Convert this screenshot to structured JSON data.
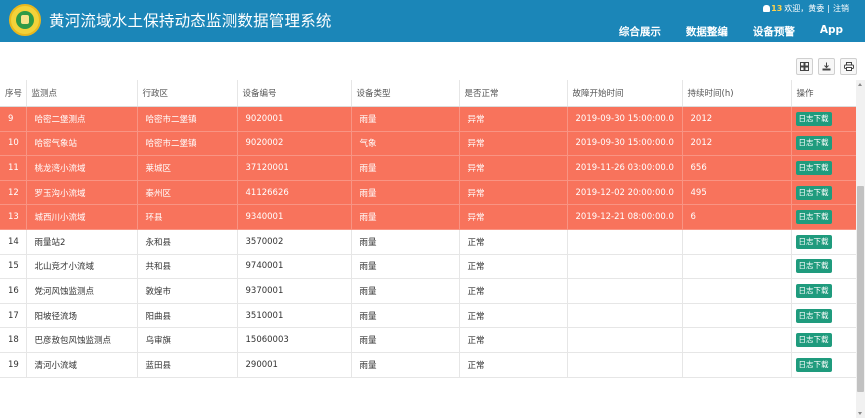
{
  "app": {
    "title": "黄河流域水土保持动态监测数据管理系统",
    "logo_icon": "logo-emblem-icon"
  },
  "user_bar": {
    "notification_count": "13",
    "welcome": "欢迎，黄委",
    "separator": "|",
    "logout": "注销"
  },
  "nav": [
    {
      "label": "综合展示"
    },
    {
      "label": "数据整编"
    },
    {
      "label": "设备预警"
    },
    {
      "label": "App"
    }
  ],
  "toolbar": {
    "columns_icon": "grid-icon",
    "export_icon": "download-icon",
    "print_icon": "print-icon"
  },
  "table": {
    "headers": [
      "序号",
      "监测点",
      "行政区",
      "设备编号",
      "设备类型",
      "是否正常",
      "故障开始时间",
      "持续时间(h)",
      "操作"
    ],
    "rows": [
      {
        "no": "9",
        "site": "哈密二堡测点",
        "region": "哈密市二堡镇",
        "device": "9020001",
        "type": "雨量",
        "status": "异常",
        "start": "2019-09-30 15:00:00.0",
        "duration": "2012",
        "action": "日志下载",
        "abnormal": true
      },
      {
        "no": "10",
        "site": "哈密气象站",
        "region": "哈密市二堡镇",
        "device": "9020002",
        "type": "气象",
        "status": "异常",
        "start": "2019-09-30 15:00:00.0",
        "duration": "2012",
        "action": "日志下载",
        "abnormal": true
      },
      {
        "no": "11",
        "site": "桃龙湾小流域",
        "region": "莱城区",
        "device": "37120001",
        "type": "雨量",
        "status": "异常",
        "start": "2019-11-26 03:00:00.0",
        "duration": "656",
        "action": "日志下载",
        "abnormal": true
      },
      {
        "no": "12",
        "site": "罗玉沟小流域",
        "region": "秦州区",
        "device": "41126626",
        "type": "雨量",
        "status": "异常",
        "start": "2019-12-02 20:00:00.0",
        "duration": "495",
        "action": "日志下载",
        "abnormal": true
      },
      {
        "no": "13",
        "site": "城西川小流域",
        "region": "环县",
        "device": "9340001",
        "type": "雨量",
        "status": "异常",
        "start": "2019-12-21 08:00:00.0",
        "duration": "6",
        "action": "日志下载",
        "abnormal": true
      },
      {
        "no": "14",
        "site": "雨量站2",
        "region": "永和县",
        "device": "3570002",
        "type": "雨量",
        "status": "正常",
        "start": "",
        "duration": "",
        "action": "日志下载",
        "abnormal": false
      },
      {
        "no": "15",
        "site": "北山竞才小流域",
        "region": "共和县",
        "device": "9740001",
        "type": "雨量",
        "status": "正常",
        "start": "",
        "duration": "",
        "action": "日志下载",
        "abnormal": false
      },
      {
        "no": "16",
        "site": "党河风蚀监测点",
        "region": "敦煌市",
        "device": "9370001",
        "type": "雨量",
        "status": "正常",
        "start": "",
        "duration": "",
        "action": "日志下载",
        "abnormal": false
      },
      {
        "no": "17",
        "site": "阳坡径流场",
        "region": "阳曲县",
        "device": "3510001",
        "type": "雨量",
        "status": "正常",
        "start": "",
        "duration": "",
        "action": "日志下载",
        "abnormal": false
      },
      {
        "no": "18",
        "site": "巴彦敖包风蚀监测点",
        "region": "乌审旗",
        "device": "15060003",
        "type": "雨量",
        "status": "正常",
        "start": "",
        "duration": "",
        "action": "日志下载",
        "abnormal": false
      },
      {
        "no": "19",
        "site": "清河小流域",
        "region": "蓝田县",
        "device": "290001",
        "type": "雨量",
        "status": "正常",
        "start": "",
        "duration": "",
        "action": "日志下载",
        "abnormal": false
      }
    ]
  },
  "colors": {
    "header_bg": "#1b86b8",
    "abnormal_row": "#f8735c",
    "download_btn": "#1f9b7d"
  }
}
